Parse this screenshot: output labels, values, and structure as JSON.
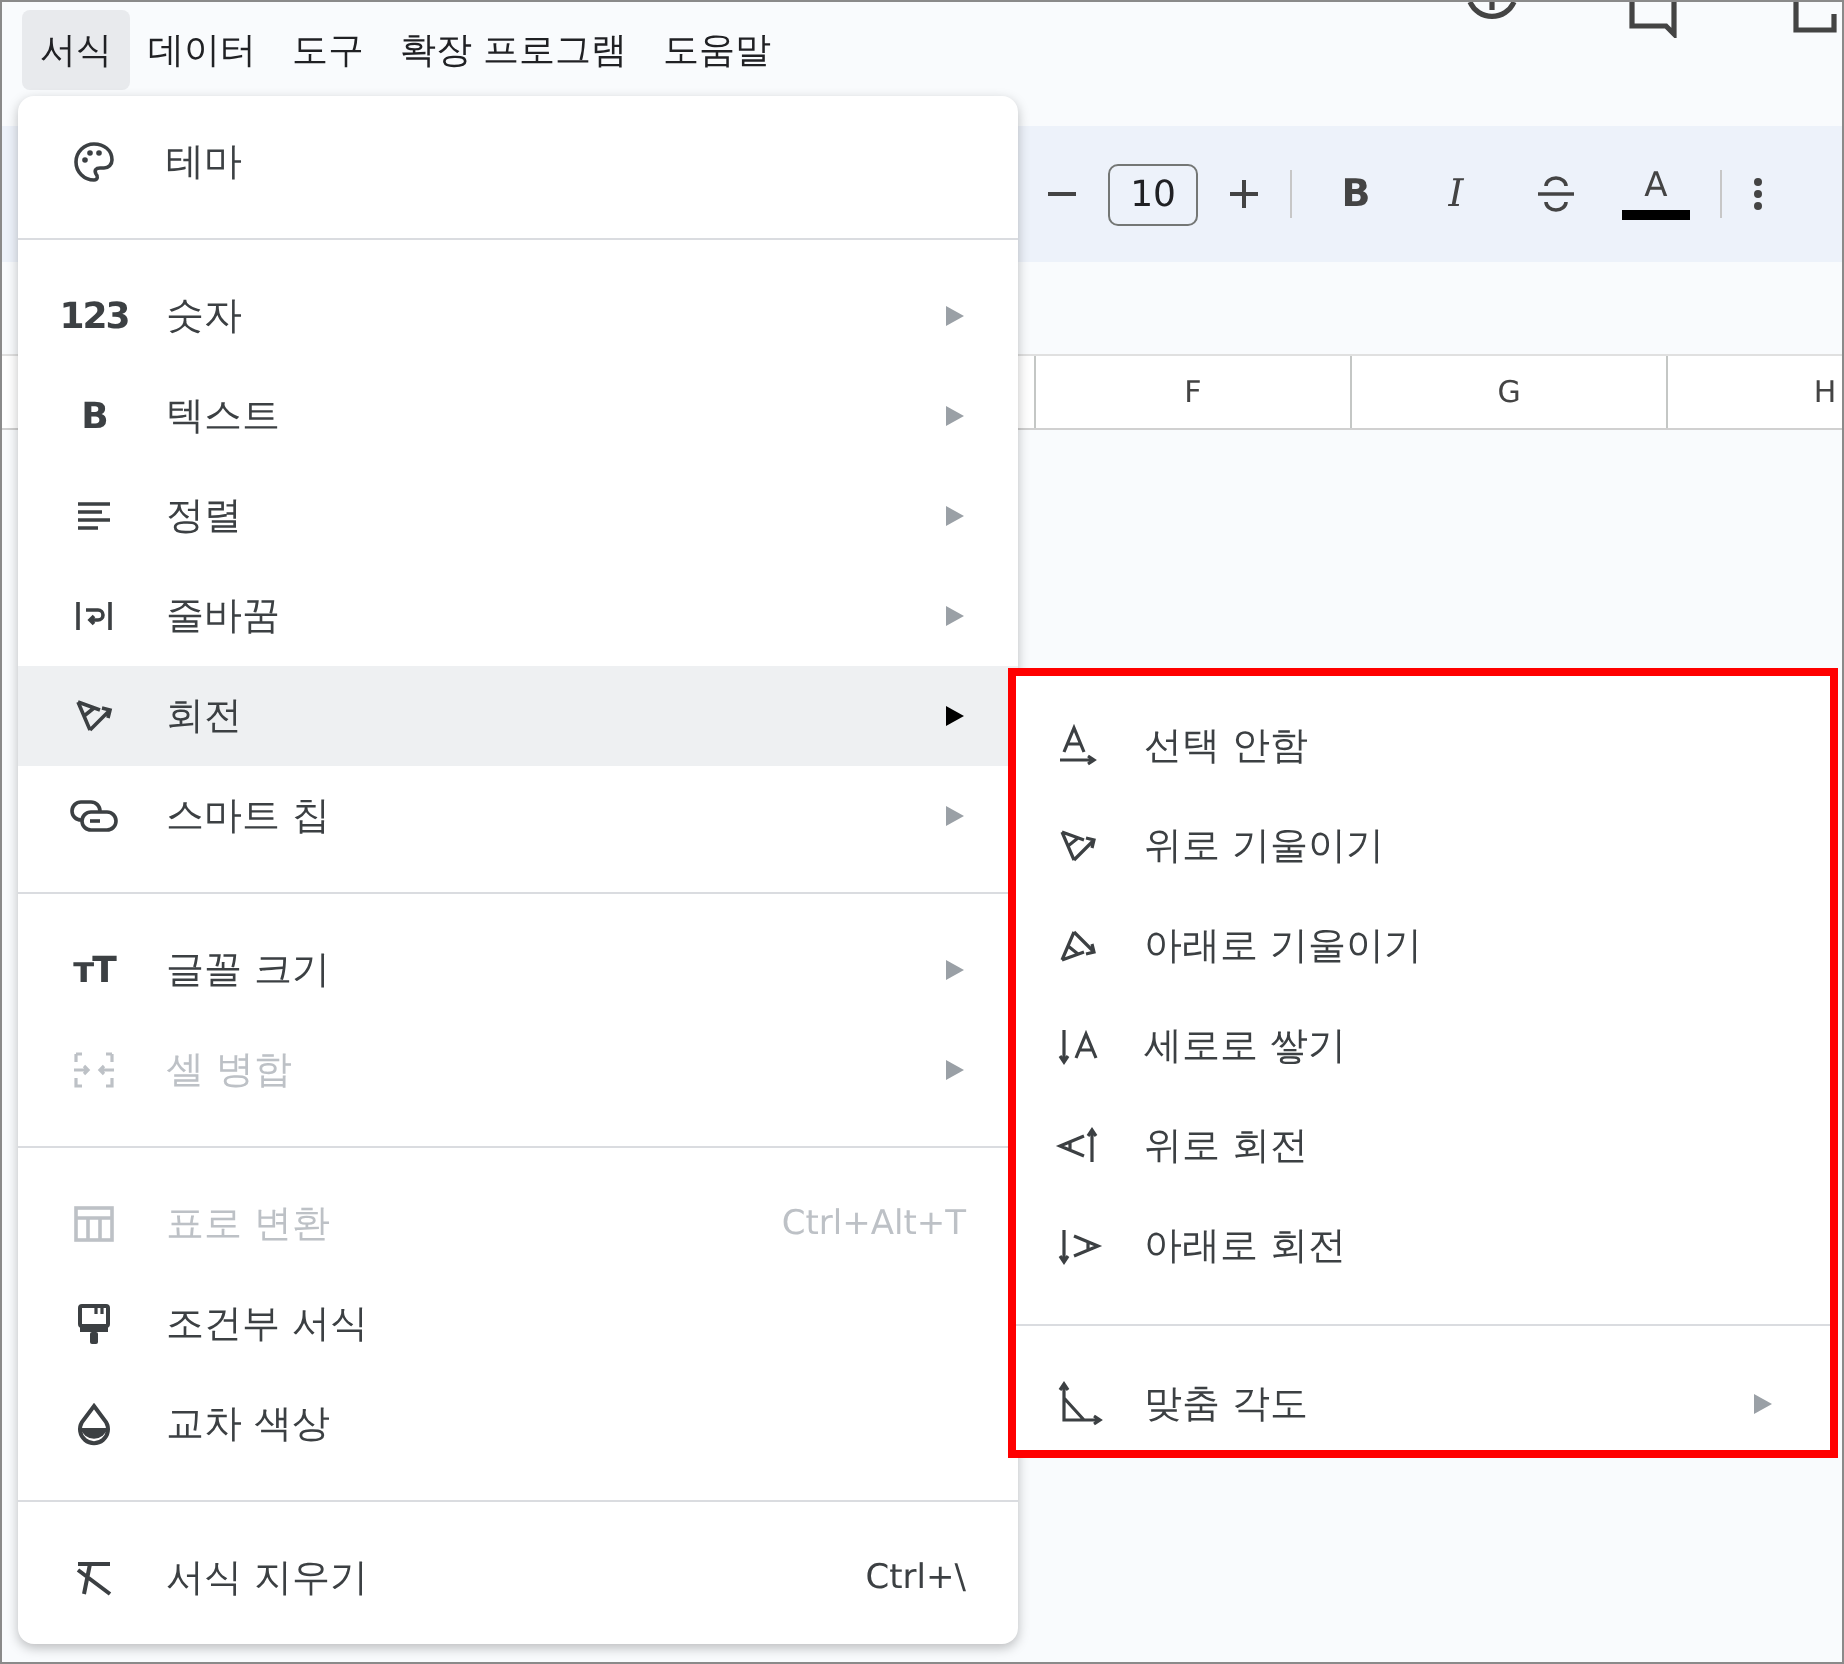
{
  "menubar": [
    {
      "label": "서식",
      "selected": true
    },
    {
      "label": "데이터",
      "selected": false
    },
    {
      "label": "도구",
      "selected": false
    },
    {
      "label": "확장 프로그램",
      "selected": false
    },
    {
      "label": "도움말",
      "selected": false
    }
  ],
  "toolbar": {
    "font_size": "10",
    "format_buttons": [
      {
        "label": "B",
        "kind": "bold"
      },
      {
        "label": "I",
        "kind": "italic"
      },
      {
        "kind": "strikethrough"
      },
      {
        "label": "A",
        "kind": "text-color",
        "color": "#000000"
      }
    ]
  },
  "columns": [
    "F",
    "G",
    "H"
  ],
  "format_menu": {
    "groups": [
      [
        {
          "label": "테마",
          "has_submenu": false,
          "disabled": false,
          "selected": false
        }
      ],
      [
        {
          "label": "숫자",
          "icon_text": "123",
          "has_submenu": true,
          "disabled": false,
          "selected": false
        },
        {
          "label": "텍스트",
          "icon_text": "B",
          "has_submenu": true,
          "disabled": false,
          "selected": false
        },
        {
          "label": "정렬",
          "has_submenu": true,
          "disabled": false,
          "selected": false
        },
        {
          "label": "줄바꿈",
          "has_submenu": true,
          "disabled": false,
          "selected": false
        },
        {
          "label": "회전",
          "has_submenu": true,
          "disabled": false,
          "selected": true
        },
        {
          "label": "스마트 칩",
          "has_submenu": true,
          "disabled": false,
          "selected": false
        }
      ],
      [
        {
          "label": "글꼴 크기",
          "icon_text": "тT",
          "has_submenu": true,
          "disabled": false,
          "selected": false
        },
        {
          "label": "셀 병합",
          "has_submenu": true,
          "disabled": true,
          "selected": false
        }
      ],
      [
        {
          "label": "표로 변환",
          "shortcut": "Ctrl+Alt+T",
          "has_submenu": false,
          "disabled": true,
          "selected": false
        },
        {
          "label": "조건부 서식",
          "has_submenu": false,
          "disabled": false,
          "selected": false
        },
        {
          "label": "교차 색상",
          "has_submenu": false,
          "disabled": false,
          "selected": false
        }
      ],
      [
        {
          "label": "서식 지우기",
          "shortcut": "Ctrl+\\",
          "has_submenu": false,
          "disabled": false,
          "selected": false
        }
      ]
    ]
  },
  "rotation_submenu": {
    "highlighted": true,
    "groups": [
      [
        {
          "label": "선택 안함",
          "has_submenu": false
        },
        {
          "label": "위로 기울이기",
          "has_submenu": false
        },
        {
          "label": "아래로 기울이기",
          "has_submenu": false
        },
        {
          "label": "세로로 쌓기",
          "has_submenu": false
        },
        {
          "label": "위로 회전",
          "has_submenu": false
        },
        {
          "label": "아래로 회전",
          "has_submenu": false
        }
      ],
      [
        {
          "label": "맞춤 각도",
          "has_submenu": true
        }
      ]
    ]
  }
}
